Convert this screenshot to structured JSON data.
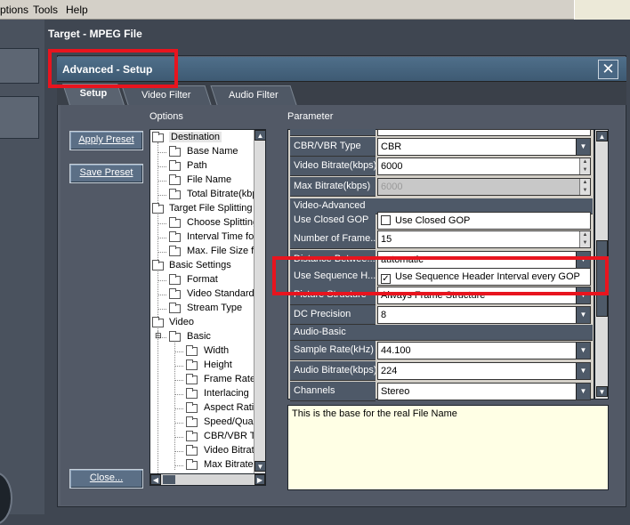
{
  "menubar": {
    "items": [
      "ptions",
      "Tools",
      "Help"
    ]
  },
  "window": {
    "title": "Target - MPEG File"
  },
  "dialog": {
    "title": "Advanced - Setup",
    "close_icon": "close-icon"
  },
  "tabs": [
    {
      "label": "Setup",
      "active": true
    },
    {
      "label": "Video Filter",
      "active": false
    },
    {
      "label": "Audio Filter",
      "active": false
    }
  ],
  "labels": {
    "options": "Options",
    "parameter": "Parameter"
  },
  "buttons": {
    "apply_preset": "Apply Preset",
    "save_preset": "Save Preset",
    "close": "Close..."
  },
  "tree": {
    "destination": "Destination",
    "base_name": "Base Name",
    "path": "Path",
    "file_name": "File Name",
    "total_bitrate": "Total Bitrate(kbps)",
    "target_file_splitting": "Target File Splitting",
    "choose_splitting": "Choose Splitting Me",
    "interval_time": "Interval Time for Sp",
    "max_file_size": "Max. File Size for S",
    "basic_settings": "Basic Settings",
    "format": "Format",
    "video_standard": "Video Standard",
    "stream_type": "Stream Type",
    "video": "Video",
    "basic": "Basic",
    "width": "Width",
    "height": "Height",
    "frame_rate": "Frame Rate(fps",
    "interlacing": "Interlacing",
    "aspect_ratio": "Aspect Ratio",
    "speed_quality": "Speed/Quality",
    "cbr_vbr_type": "CBR/VBR Typ",
    "video_bitrate": "Video Bitrate(k",
    "max_bitrate": "Max Bitrate(kbp"
  },
  "params": {
    "cbr_vbr": {
      "name": "CBR/VBR Type",
      "value": "CBR"
    },
    "video_bitrate": {
      "name": "Video Bitrate(kbps)",
      "value": "6000"
    },
    "max_bitrate": {
      "name": "Max Bitrate(kbps)",
      "value": "6000"
    },
    "section_video_advanced": "Video-Advanced",
    "closed_gop": {
      "name": "Use Closed GOP",
      "value": "Use Closed GOP",
      "checked": false
    },
    "num_frames": {
      "name": "Number of Frame...",
      "value": "15"
    },
    "distance": {
      "name": "Distance Betwee...",
      "value": "automatic"
    },
    "seq_header": {
      "name": "Use Sequence H...",
      "value": "Use Sequence Header Interval every GOP",
      "checked": true
    },
    "picture_structure": {
      "name": "Picture Structure",
      "value": "Always Frame Structure"
    },
    "dc_precision": {
      "name": "DC Precision",
      "value": "8"
    },
    "section_audio_basic": "Audio-Basic",
    "sample_rate": {
      "name": "Sample Rate(kHz)",
      "value": "44.100"
    },
    "audio_bitrate": {
      "name": "Audio Bitrate(kbps)",
      "value": "224"
    },
    "channels": {
      "name": "Channels",
      "value": "Stereo"
    }
  },
  "description": "This is the base for the real File Name",
  "colors": {
    "highlight": "#e8141e",
    "panel": "#585f6b",
    "header": "#4e5968"
  }
}
